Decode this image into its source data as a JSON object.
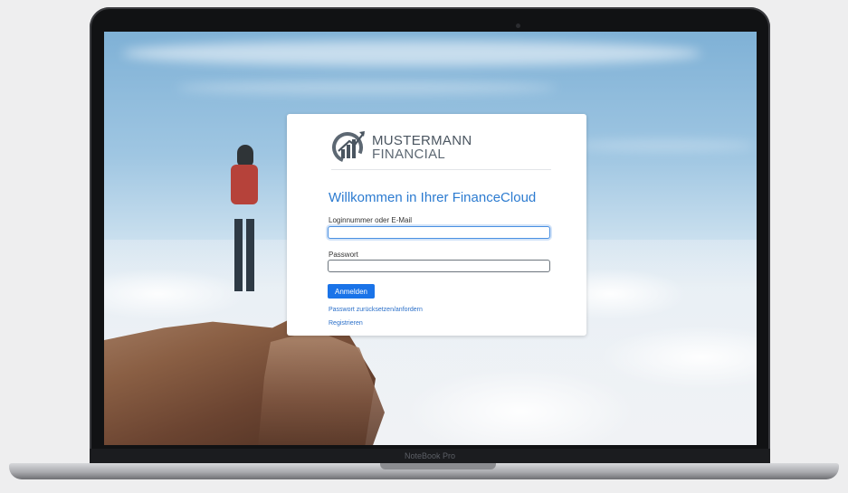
{
  "device": {
    "brand_label": "NoteBook Pro"
  },
  "login": {
    "logo": {
      "line1": "MUSTERMANN",
      "line2": "FINANCIAL",
      "icon": "chart-gauge-logo-icon"
    },
    "welcome_title": "Willkommen in Ihrer FinanceCloud",
    "username": {
      "label": "Loginnummer oder E-Mail",
      "value": "",
      "placeholder": ""
    },
    "password": {
      "label": "Passwort",
      "value": "",
      "placeholder": ""
    },
    "submit_label": "Anmelden",
    "links": {
      "reset_password": "Passwort zurücksetzen/anfordern",
      "register": "Registrieren"
    }
  },
  "colors": {
    "accent": "#1a73e8",
    "title": "#2c7bd0",
    "logo_gray": "#4a5560"
  }
}
